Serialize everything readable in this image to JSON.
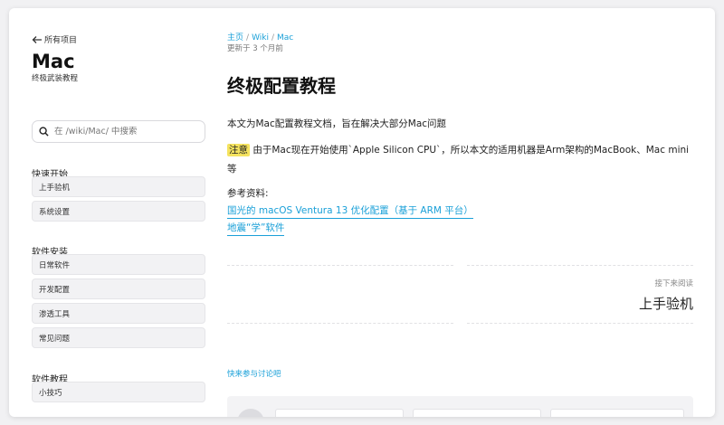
{
  "sidebar": {
    "back_label": "所有项目",
    "title": "Mac",
    "subtitle": "终极武装教程",
    "search_placeholder": "在 /wiki/Mac/ 中搜索",
    "sections": [
      {
        "label": "快速开始",
        "items": [
          "上手验机",
          "系统设置"
        ]
      },
      {
        "label": "软件安装",
        "items": [
          "日常软件",
          "开发配置",
          "渗透工具",
          "常见问题"
        ]
      },
      {
        "label": "软件教程",
        "items": [
          "小技巧"
        ]
      }
    ]
  },
  "main": {
    "breadcrumb": [
      "主页",
      "Wiki",
      "Mac"
    ],
    "updated": "更新于 3 个月前",
    "title": "终极配置教程",
    "intro": "本文为Mac配置教程文档，旨在解决大部分Mac问题",
    "note_tag": "注意",
    "note_text": "由于Mac现在开始使用`Apple Silicon CPU`，所以本文的适用机器是Arm架构的MacBook、Mac mini等",
    "refs_label": "参考资料:",
    "links": [
      "国光的 macOS Ventura 13 优化配置（基于 ARM 平台）",
      "地震“学”软件"
    ],
    "next_label": "接下来阅读",
    "next_title": "上手验机",
    "discuss_label": "快来参与讨论吧"
  },
  "colors": {
    "accent": "#1aa0d8",
    "highlight": "#f5e35f"
  }
}
